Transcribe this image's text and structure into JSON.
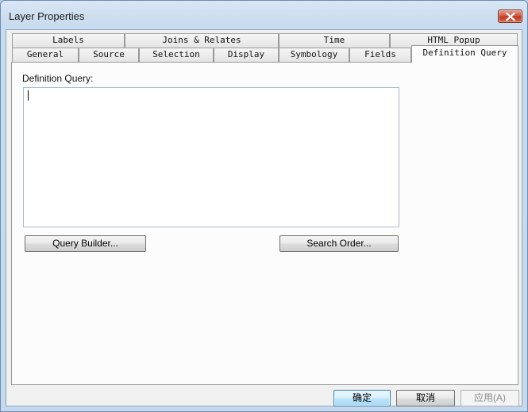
{
  "window": {
    "title": "Layer Properties",
    "close_icon": "close-icon"
  },
  "tabs_row1": [
    "Labels",
    "Joins & Relates",
    "Time",
    "HTML Popup"
  ],
  "tabs_row2": [
    "General",
    "Source",
    "Selection",
    "Display",
    "Symbology",
    "Fields"
  ],
  "active_tab": "Definition Query",
  "panel": {
    "label": "Definition Query:",
    "query_value": "",
    "query_builder_label": "Query Builder...",
    "search_order_label": "Search Order..."
  },
  "footer": {
    "ok_label": "确定",
    "cancel_label": "取消",
    "apply_label": "应用(A)"
  },
  "colors": {
    "accent": "#3c7fb1",
    "close_red": "#c0381e"
  }
}
